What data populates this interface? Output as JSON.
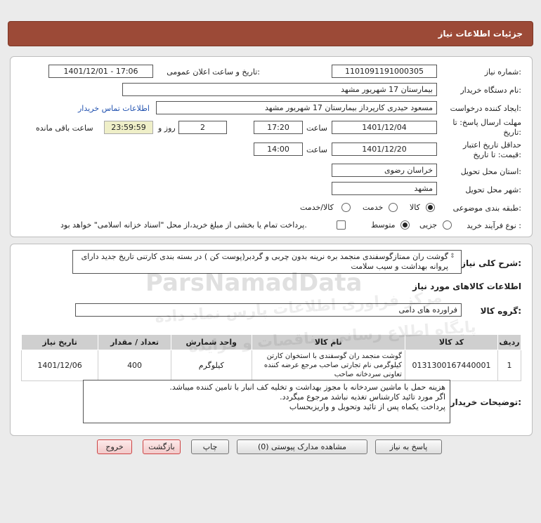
{
  "page_title": "جزئیات اطلاعات نیاز",
  "need_number": {
    "label": "شماره نیاز:",
    "value": "1101091191000305"
  },
  "announce_datetime": {
    "label": "تاریخ و ساعت اعلان عمومی:",
    "value": "1401/12/01 - 17:06"
  },
  "buyer_org": {
    "label": "نام دستگاه خریدار:",
    "value": "بیمارستان 17 شهریور مشهد"
  },
  "requester": {
    "label": "ایجاد کننده درخواست:",
    "value": "مسعود حیدری کارپرداز بیمارستان 17 شهریور مشهد",
    "contact_link": "اطلاعات تماس خریدار"
  },
  "reply_deadline": {
    "label1": "مهلت ارسال پاسخ: تا",
    "label2": "تاریخ:",
    "date": "1401/12/04",
    "time_label": "ساعت",
    "time": "17:20",
    "days": "2",
    "days_label": "روز و",
    "remaining": "23:59:59",
    "remaining_label": "ساعت باقی مانده"
  },
  "price_validity": {
    "label1": "حداقل تاریخ اعتبار",
    "label2": "قیمت: تا تاریخ:",
    "date": "1401/12/20",
    "time_label": "ساعت",
    "time": "14:00"
  },
  "province": {
    "label": "استان محل تحویل:",
    "value": "خراسان رضوی"
  },
  "city": {
    "label": "شهر محل تحویل:",
    "value": "مشهد"
  },
  "category": {
    "label": "طبقه بندی موضوعی:",
    "options": [
      "کالا",
      "خدمت",
      "کالا/خدمت"
    ],
    "selected": "کالا"
  },
  "purchase_type": {
    "label": "نوع فرآیند خرید :",
    "options": [
      "جزیی",
      "متوسط"
    ],
    "selected": "متوسط",
    "treasury_note": "پرداخت تمام یا بخشی از مبلغ خرید،از محل \"اسناد خزانه اسلامی\" خواهد بود."
  },
  "general_description": {
    "label": "شرح کلی نیاز:",
    "value": "گوشت ران ممتازگوسفندی منجمد بره نرینه بدون چربی و گردبر(پوست کن ) در بسته بندی کارتنی تاریخ جدید دارای پروانه بهداشت و سیب سلامت"
  },
  "goods_info_title": "اطلاعات کالاهای مورد نیاز",
  "goods_group": {
    "label": "گروه کالا:",
    "value": "فراورده های دامی"
  },
  "table": {
    "headers": [
      "ردیف",
      "کد کالا",
      "نام کالا",
      "واحد شمارش",
      "تعداد / مقدار",
      "تاریخ نیاز"
    ],
    "rows": [
      {
        "row": "1",
        "code": "0131300167440001",
        "name": "گوشت منجمد ران گوسفندی با استخوان کارتن کیلوگرمی نام تجارتی صاحب مرجع عرضه کننده تعاونی سردخانه صاحب",
        "unit": "کیلوگرم",
        "qty": "400",
        "date": "1401/12/06"
      }
    ]
  },
  "buyer_notes": {
    "label": "توضیحات خریدار:",
    "lines": [
      "هزینه حمل با ماشین سردخانه با مجوز بهداشت و تخلیه کف انبار با تامین کننده میباشد.",
      "اگر مورد تائید کارشناس تغذیه نباشد مرجوع میگردد.",
      "پرداخت یکماه پس از تائید وتحویل و واریزبحساب"
    ]
  },
  "buttons": {
    "reply": "پاسخ به نیاز",
    "view_docs": "مشاهده مدارک پیوستی (0)",
    "print": "چاپ",
    "back": "بازگشت",
    "exit": "خروج"
  },
  "watermark": {
    "brand": "ParsNamadData",
    "line1": "مرکز فراوری اطلاعات پارس نماد داده",
    "line2": "پایگاه اطلاع رسانی مناقصات و مزایده"
  }
}
